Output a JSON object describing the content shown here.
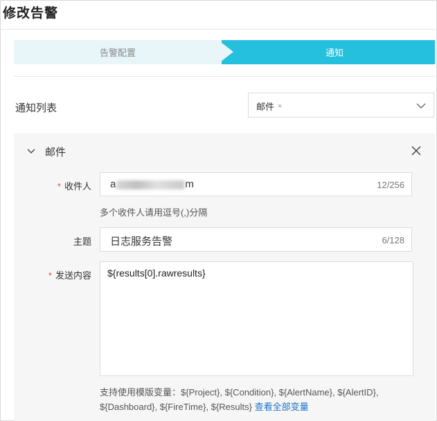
{
  "page": {
    "title": "修改告警"
  },
  "steps": [
    {
      "label": "告警配置",
      "active": false
    },
    {
      "label": "通知",
      "active": true
    }
  ],
  "notify": {
    "label": "通知列表",
    "selected_tag": "邮件",
    "tag_remove": "×"
  },
  "email_panel": {
    "title": "邮件",
    "recipients": {
      "label": "收件人",
      "value_prefix": "a",
      "value_suffix": "m",
      "counter": "12/256",
      "hint": "多个收件人请用逗号(,)分隔"
    },
    "subject": {
      "label": "主题",
      "value": "日志服务告警",
      "counter": "6/128"
    },
    "content": {
      "label": "发送内容",
      "value": "${results[0].rawresults}"
    },
    "variables_hint": {
      "prefix": "支持使用模版变量：",
      "line1": "${Project}, ${Condition}, ${AlertName}, ${AlertID},",
      "line2": "${Dashboard}, ${FireTime}, ${Results}",
      "link": "查看全部变量"
    }
  },
  "colors": {
    "accent": "#25c0dd",
    "step_inactive_bg": "#e8f6fa",
    "required": "#e04b4b",
    "link": "#1a73c9",
    "panel_bg": "#f6f6f6"
  },
  "icons": {
    "select_chevron": "chevron-down-icon",
    "panel_chevron": "chevron-down-icon",
    "panel_close": "close-icon"
  }
}
